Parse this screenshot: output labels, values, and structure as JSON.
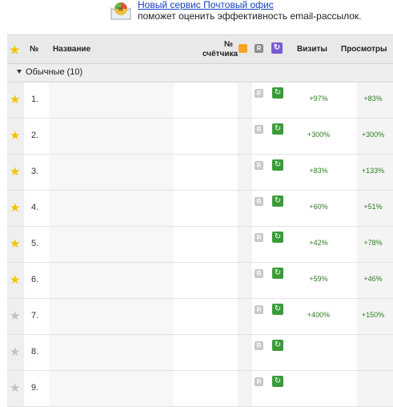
{
  "promo": {
    "link_text": "Новый сервис Почтовый офис",
    "description": "поможет оценить эффективность email-рассылок."
  },
  "header": {
    "num": "№",
    "name": "Название",
    "counter_line1": "№",
    "counter_line2": "счётчика",
    "visits": "Визиты",
    "views": "Просмотры"
  },
  "group": {
    "label": "Обычные (10)"
  },
  "rows": [
    {
      "num": "1.",
      "starred": true,
      "visits": "+97%",
      "views": "+83%"
    },
    {
      "num": "2.",
      "starred": true,
      "visits": "+300%",
      "views": "+300%"
    },
    {
      "num": "3.",
      "starred": true,
      "visits": "+83%",
      "views": "+133%"
    },
    {
      "num": "4.",
      "starred": true,
      "visits": "+60%",
      "views": "+51%"
    },
    {
      "num": "5.",
      "starred": true,
      "visits": "+42%",
      "views": "+78%"
    },
    {
      "num": "6.",
      "starred": true,
      "visits": "+59%",
      "views": "+46%"
    },
    {
      "num": "7.",
      "starred": false,
      "visits": "+400%",
      "views": "+150%"
    },
    {
      "num": "8.",
      "starred": false,
      "visits": "",
      "views": ""
    },
    {
      "num": "9.",
      "starred": false,
      "visits": "",
      "views": ""
    }
  ],
  "colors": {
    "star_on": "#f2c500",
    "star_off": "#c2c2c2",
    "positive": "#2e7d1f",
    "link": "#1a3dc1"
  },
  "icons": {
    "header_star": "star-icon",
    "report_r": "report-icon",
    "refresh": "refresh-icon"
  }
}
